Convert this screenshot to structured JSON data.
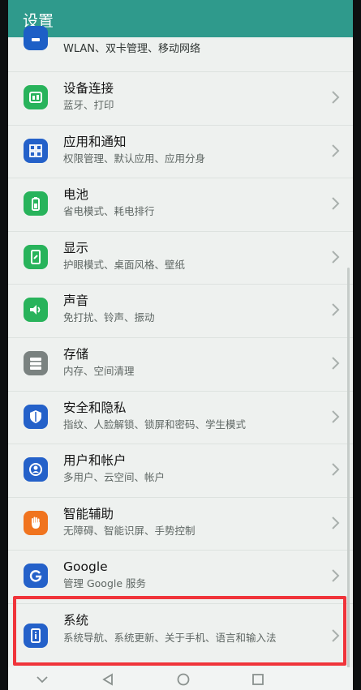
{
  "appbar": {
    "title": "设置"
  },
  "items": [
    {
      "title": "",
      "subtitle": "WLAN、双卡管理、移动网络",
      "icon": "network-icon",
      "color": "#1d5fc6"
    },
    {
      "title": "设备连接",
      "subtitle": "蓝牙、打印",
      "icon": "device-connect-icon",
      "color": "#28b35b"
    },
    {
      "title": "应用和通知",
      "subtitle": "权限管理、默认应用、应用分身",
      "icon": "apps-grid-icon",
      "color": "#2461c9"
    },
    {
      "title": "电池",
      "subtitle": "省电模式、耗电排行",
      "icon": "battery-icon",
      "color": "#28b35b"
    },
    {
      "title": "显示",
      "subtitle": "护眼模式、桌面风格、壁纸",
      "icon": "display-icon",
      "color": "#28b35b"
    },
    {
      "title": "声音",
      "subtitle": "免打扰、铃声、振动",
      "icon": "speaker-icon",
      "color": "#28b35b"
    },
    {
      "title": "存储",
      "subtitle": "内存、空间清理",
      "icon": "storage-icon",
      "color": "#7a8280"
    },
    {
      "title": "安全和隐私",
      "subtitle": "指纹、人脸解锁、锁屏和密码、学生模式",
      "icon": "shield-icon",
      "color": "#2461c9"
    },
    {
      "title": "用户和帐户",
      "subtitle": "多用户、云空间、帐户",
      "icon": "user-icon",
      "color": "#2461c9"
    },
    {
      "title": "智能辅助",
      "subtitle": "无障碍、智能识屏、手势控制",
      "icon": "hand-icon",
      "color": "#f0741f"
    },
    {
      "title": "Google",
      "subtitle": "管理 Google 服务",
      "icon": "google-icon",
      "color": "#2461c9"
    },
    {
      "title": "系统",
      "subtitle": "系统导航、系统更新、关于手机、语言和输入法",
      "icon": "system-info-icon",
      "color": "#2461c9"
    }
  ],
  "navbar": {
    "back": "back-icon",
    "home": "home-icon",
    "recents": "recents-icon"
  }
}
